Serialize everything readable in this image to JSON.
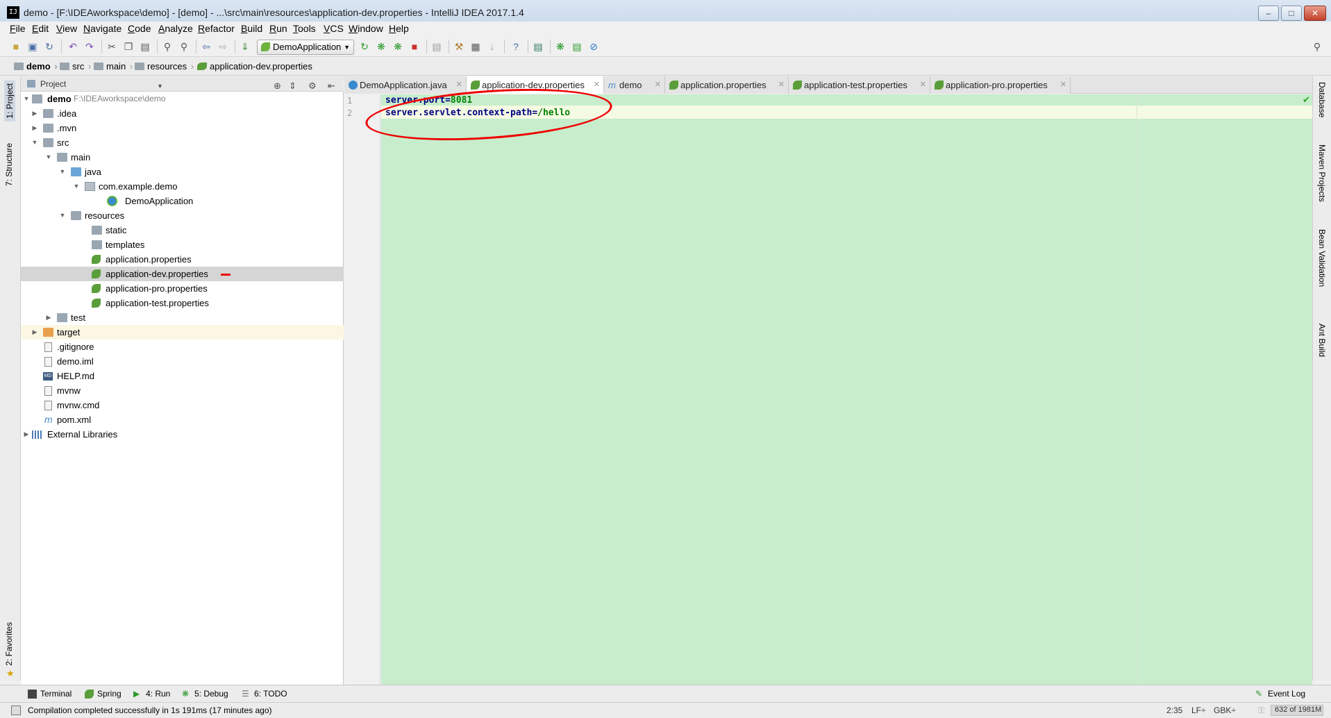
{
  "window": {
    "title": "demo - [F:\\IDEAworkspace\\demo] - [demo] - ...\\src\\main\\resources\\application-dev.properties - IntelliJ IDEA 2017.1.4",
    "app_icon_label": "IJ",
    "controls": [
      "–",
      "□",
      "✕"
    ]
  },
  "menu": [
    "File",
    "Edit",
    "View",
    "Navigate",
    "Code",
    "Analyze",
    "Refactor",
    "Build",
    "Run",
    "Tools",
    "VCS",
    "Window",
    "Help"
  ],
  "toolbar": {
    "run_config": "DemoApplication"
  },
  "breadcrumb": [
    "demo",
    "src",
    "main",
    "resources",
    "application-dev.properties"
  ],
  "left_strip": {
    "project": "1: Project",
    "structure": "7: Structure",
    "favorites": "2: Favorites"
  },
  "right_strip": {
    "database": "Database",
    "maven": "Maven Projects",
    "bean": "Bean Validation",
    "ant": "Ant Build"
  },
  "project_panel": {
    "title": "Project",
    "tree": [
      {
        "label": "demo",
        "path": "F:\\IDEAworkspace\\demo"
      },
      {
        "label": ".idea"
      },
      {
        "label": ".mvn"
      },
      {
        "label": "src"
      },
      {
        "label": "main"
      },
      {
        "label": "java"
      },
      {
        "label": "com.example.demo"
      },
      {
        "label": "DemoApplication"
      },
      {
        "label": "resources"
      },
      {
        "label": "static"
      },
      {
        "label": "templates"
      },
      {
        "label": "application.properties"
      },
      {
        "label": "application-dev.properties"
      },
      {
        "label": "application-pro.properties"
      },
      {
        "label": "application-test.properties"
      },
      {
        "label": "test"
      },
      {
        "label": "target"
      },
      {
        "label": ".gitignore"
      },
      {
        "label": "demo.iml"
      },
      {
        "label": "HELP.md"
      },
      {
        "label": "mvnw"
      },
      {
        "label": "mvnw.cmd"
      },
      {
        "label": "pom.xml"
      },
      {
        "label": "External Libraries"
      }
    ]
  },
  "editor": {
    "tabs": [
      {
        "label": "DemoApplication.java"
      },
      {
        "label": "application-dev.properties"
      },
      {
        "label": "demo"
      },
      {
        "label": "application.properties"
      },
      {
        "label": "application-test.properties"
      },
      {
        "label": "application-pro.properties"
      }
    ],
    "line_numbers": [
      "1",
      "2"
    ],
    "lines": [
      {
        "key": "server.port",
        "eq": "=",
        "value": "8081"
      },
      {
        "key": "server.servlet.context-path",
        "eq": "=",
        "value": "/hello"
      }
    ]
  },
  "bottom_tabs": [
    "Terminal",
    "Spring",
    "4: Run",
    "5: Debug",
    "6: TODO",
    "Event Log"
  ],
  "status": {
    "message": "Compilation completed successfully in 1s 191ms (17 minutes ago)",
    "position": "2:35",
    "line_sep": "LF÷",
    "encoding": "GBK÷",
    "memory": "632 of 1981M"
  },
  "colors": {
    "editor_bg": "#c7edcc",
    "annotation": "#ee0000",
    "property_key": "#000080",
    "property_value": "#008000"
  }
}
